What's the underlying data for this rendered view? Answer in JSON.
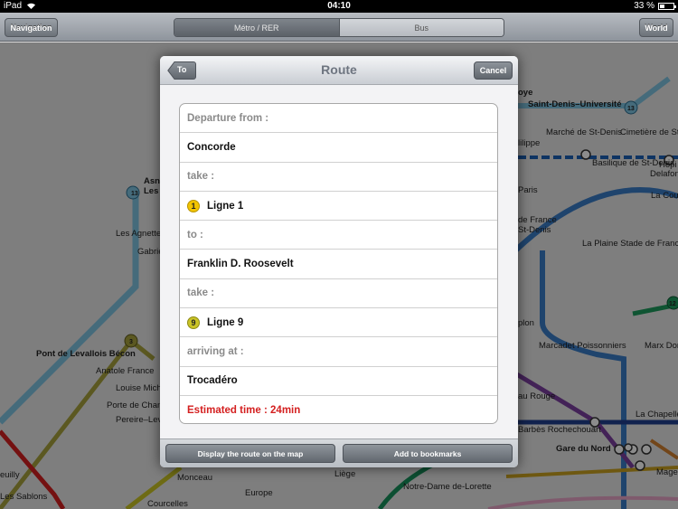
{
  "status_bar": {
    "device": "iPad",
    "time": "04:10",
    "battery": "33 %",
    "battery_level_percent": 33
  },
  "toolbar": {
    "navigation_label": "Navigation",
    "world_label": "World",
    "segments": [
      {
        "label": "Métro / RER",
        "selected": true
      },
      {
        "label": "Bus",
        "selected": false
      }
    ]
  },
  "map": {
    "labels": [
      "Saint-Denis–Université",
      "Marché de St-Denis",
      "Cimetière de St-Denis",
      "Basilique de St-Denis",
      "La Cour Aubervilliers",
      "La Plaine Stade de France",
      "Marcadet Poissonniers",
      "Marx Dormoy",
      "Gare du Nord",
      "La Chapelle",
      "Barbès Rochechouart",
      "Notre-Dame de-Lorette",
      "Pont de Levallois Bécon",
      "Anatole France",
      "Louise Michel",
      "Porte de Champerret",
      "Pereire–Levallois",
      "Les Agnettes",
      "Gabriel Péri",
      "Monceau",
      "Europe",
      "Liège",
      "Courcelles",
      "Les Sablons",
      "Asnières",
      "Les",
      "Hôpi",
      "Delafon",
      "Magenta",
      "de France",
      "St-Denis",
      "Paris",
      "lilippe",
      "oye",
      "plon",
      "au Rouge",
      "euilly"
    ],
    "line_numbers": [
      "13",
      "13",
      "3",
      "12"
    ]
  },
  "modal": {
    "back_label": "To",
    "title": "Route",
    "cancel_label": "Cancel",
    "rows": {
      "departure_heading": "Departure from :",
      "departure_station": "Concorde",
      "take_heading_1": "take :",
      "line_1_number": "1",
      "line_1_name": "Ligne 1",
      "to_heading": "to :",
      "transfer_station": "Franklin D. Roosevelt",
      "take_heading_2": "take :",
      "line_2_number": "9",
      "line_2_name": "Ligne 9",
      "arriving_heading": "arriving at :",
      "arrival_station": "Trocadéro",
      "estimated_time": "Estimated time : 24min"
    },
    "footer": {
      "display_route_label": "Display the route on the map",
      "add_bookmarks_label": "Add to bookmarks"
    }
  },
  "colors": {
    "alert_red": "#d42020",
    "line_1_yellow": "#f2c400",
    "line_9_olive": "#c9c326"
  }
}
